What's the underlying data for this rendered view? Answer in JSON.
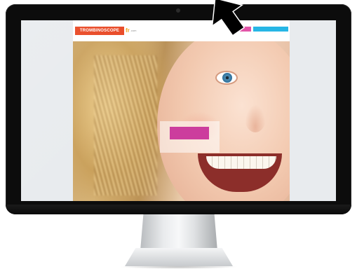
{
  "site": {
    "logo_text": "TROMBINOSCOPE",
    "logo_suffix": "fr",
    "logo_domain": ".com",
    "tagline": "",
    "header_buttons": {
      "pink_label": "",
      "blue_label": ""
    },
    "promo_left": "",
    "promo_right": "",
    "center_box": {
      "button_label": "",
      "caption": "",
      "link_text": ""
    }
  },
  "colors": {
    "monitor_bezel": "#0c0c0c",
    "logo_bg": "#e8441f",
    "pink_button": "#e255a8",
    "blue_button": "#27b6e5",
    "enter_button": "#cc3d9d"
  },
  "icons": {
    "cursor": "arrow-cursor-icon"
  }
}
